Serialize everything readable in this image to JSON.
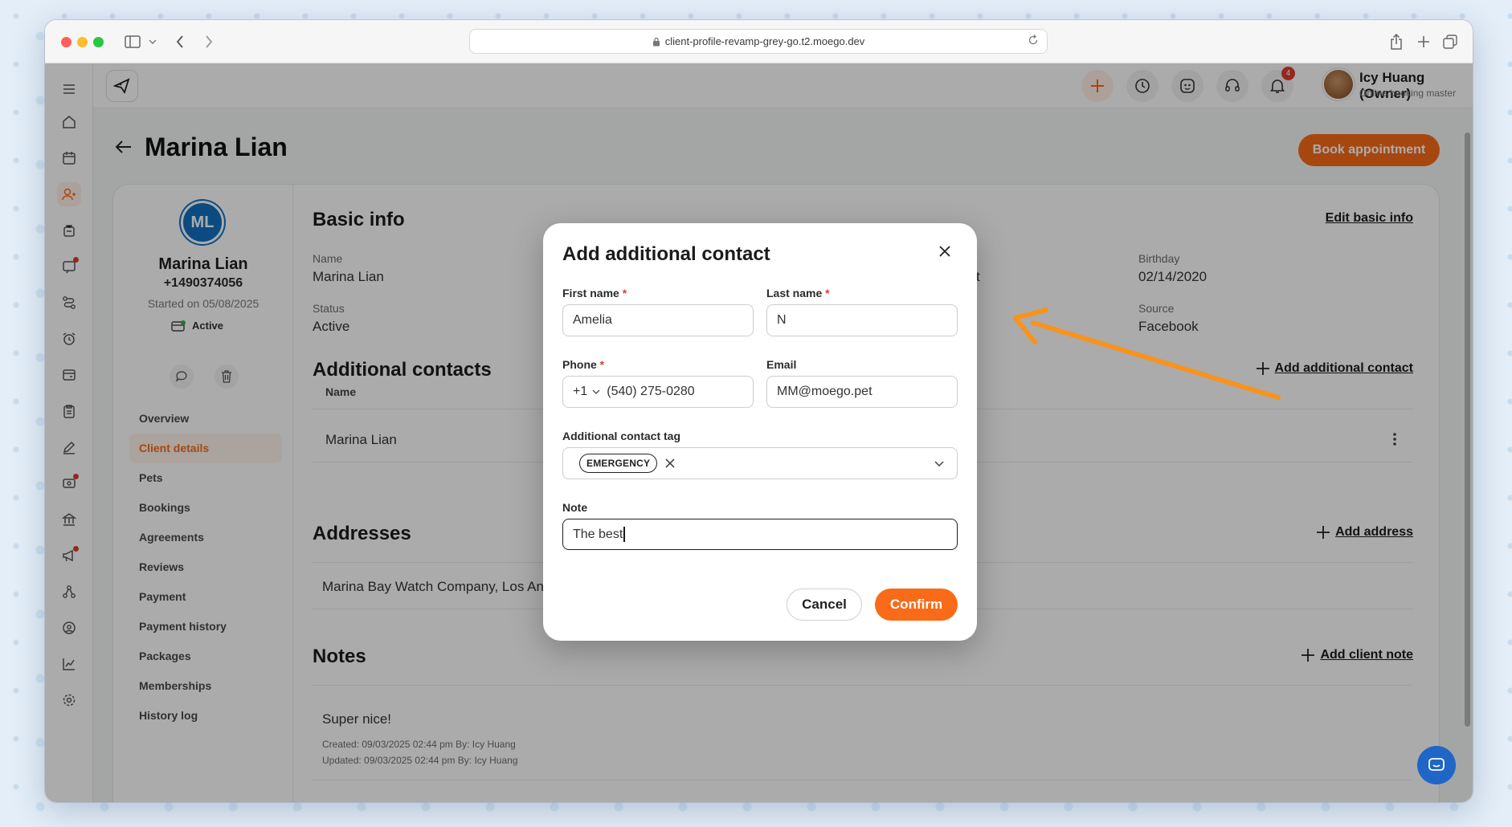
{
  "browser": {
    "url": "client-profile-revamp-grey-go.t2.moego.dev"
  },
  "topbar": {
    "notification_count": "4",
    "user_name": "Icy Huang (Owner)",
    "user_role": "Online booking master"
  },
  "page": {
    "title": "Marina Lian",
    "book_button": "Book appointment"
  },
  "profile": {
    "initials": "ML",
    "name": "Marina Lian",
    "phone": "+1490374056",
    "started": "Started on 05/08/2025",
    "status": "Active"
  },
  "sidemenu": {
    "items": [
      {
        "label": "Overview"
      },
      {
        "label": "Client details"
      },
      {
        "label": "Pets"
      },
      {
        "label": "Bookings"
      },
      {
        "label": "Agreements"
      },
      {
        "label": "Reviews"
      },
      {
        "label": "Payment"
      },
      {
        "label": "Payment history"
      },
      {
        "label": "Packages"
      },
      {
        "label": "Memberships"
      },
      {
        "label": "History log"
      }
    ]
  },
  "basic_info": {
    "title": "Basic info",
    "edit_link": "Edit basic info",
    "name_label": "Name",
    "name_value": "Marina Lian",
    "status_label": "Status",
    "status_value": "Active",
    "birthday_label": "Birthday",
    "birthday_value": "02/14/2020",
    "source_label": "Source",
    "source_value": "Facebook",
    "partial_value": "t"
  },
  "additional_contacts": {
    "title": "Additional contacts",
    "add_link": "Add additional contact",
    "column_name": "Name",
    "rows": [
      {
        "name": "Marina Lian"
      }
    ]
  },
  "addresses": {
    "title": "Addresses",
    "add_link": "Add address",
    "rows": [
      {
        "address": "Marina Bay Watch Company, Los Ang"
      }
    ]
  },
  "notes": {
    "title": "Notes",
    "add_link": "Add client note",
    "items": [
      {
        "text": "Super nice!",
        "created": "Created: 09/03/2025 02:44 pm By: Icy Huang",
        "updated": "Updated: 09/03/2025 02:44 pm By: Icy Huang"
      }
    ]
  },
  "modal": {
    "title": "Add additional contact",
    "first_name_label": "First name",
    "first_name_value": "Amelia",
    "last_name_label": "Last name",
    "last_name_value": "N",
    "required_mark": "*",
    "phone_label": "Phone",
    "phone_country": "+1",
    "phone_value": "(540) 275-0280",
    "email_label": "Email",
    "email_value": "MM@moego.pet",
    "tag_label": "Additional contact tag",
    "tag_value": "EMERGENCY",
    "note_label": "Note",
    "note_value": "The best",
    "cancel_label": "Cancel",
    "confirm_label": "Confirm"
  },
  "colors": {
    "accent": "#f96b18",
    "avatar_blue": "#1170c2",
    "annotation_arrow": "#f7931e"
  }
}
